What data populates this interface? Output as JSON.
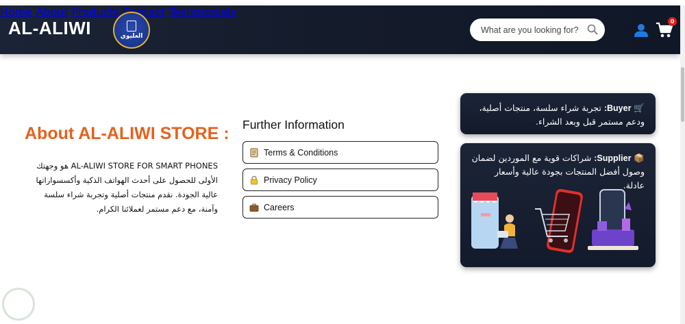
{
  "header": {
    "brand": "AL-ALIWI",
    "logo_text": "العليوي",
    "nav": [
      "Home",
      "About",
      "Products",
      "Contact",
      "Testimonials"
    ],
    "search_placeholder": "What are you looking for?",
    "cart_count": "0",
    "icons": [
      "search-icon",
      "user-icon",
      "cart-icon"
    ],
    "accent": "#1e7be0"
  },
  "about": {
    "title": "About AL-ALIWI STORE :",
    "text": "AL-ALIWI STORE FOR SMART PHONES هو وجهتك الأولى للحصول على أحدث الهواتف الذكية وأكسسواراتها عالية الجودة. نقدم منتجات أصلية وتجربة شراء سلسة وآمنة، مع دعم مستمر لعملائنا الكرام.",
    "title_color": "#e3621f"
  },
  "further": {
    "title": "Further Information",
    "links": [
      {
        "icon": "scroll-icon",
        "label": "Terms & Conditions"
      },
      {
        "icon": "lock-icon",
        "label": "Privacy Policy"
      },
      {
        "icon": "briefcase-icon",
        "label": "Careers"
      }
    ]
  },
  "cards": {
    "buyer": {
      "label": "Buyer:",
      "text": "تجربة شراء سلسة، منتجات أصلية، ودعم مستمر قبل وبعد الشراء."
    },
    "supplier": {
      "label": "Supplier:",
      "text": "شراكات قوية مع الموردين لضمان وصول أفضل المنتجات بجودة عالية وأسعار عادلة."
    }
  }
}
